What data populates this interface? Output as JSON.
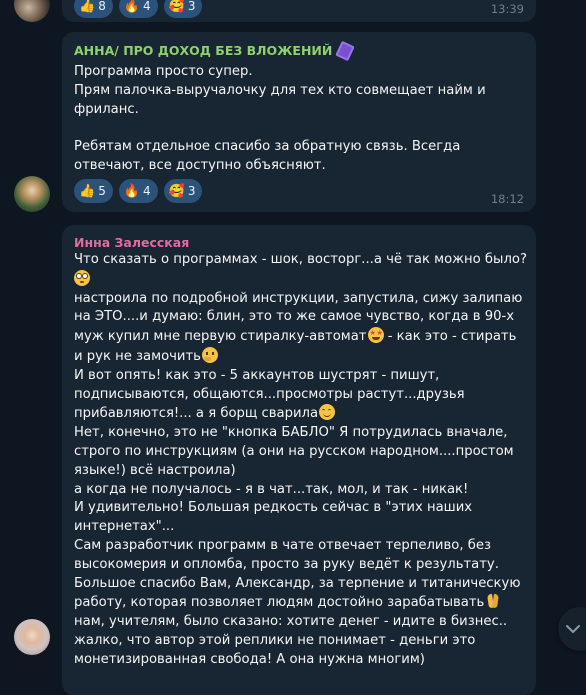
{
  "top_message": {
    "reactions": [
      {
        "icon": "thumbs-up-emoji",
        "count": "8"
      },
      {
        "icon": "fire-emoji",
        "count": "4"
      },
      {
        "icon": "heart-face-emoji",
        "count": "3"
      }
    ],
    "time": "13:39"
  },
  "message_anna": {
    "author": "АННА/ ПРО ДОХОД БЕЗ ВЛОЖЕНИЙ",
    "author_color": "#8fd16a",
    "lines": [
      "Программа просто супер.",
      "Прям палочка-выручалочку  для тех кто совмещает найм и",
      "фриланс.",
      "",
      "Ребятам отдельное спасибо за обратную связь. Всегда",
      "отвечают,  все доступно объясняют."
    ],
    "reactions": [
      {
        "icon": "thumbs-up-emoji",
        "count": "5"
      },
      {
        "icon": "fire-emoji",
        "count": "4"
      },
      {
        "icon": "heart-face-emoji",
        "count": "3"
      }
    ],
    "time": "18:12"
  },
  "message_inna": {
    "author": "Инна Залесская",
    "author_color": "#e56a9e",
    "lines": [
      "Что сказать о программах - шок, восторг...а чё так можно было?",
      "настроила по подробной инструкции, запустила, сижу залипаю",
      "на ЭТО....и думаю: блин, это то же самое чувство, когда в 90-х",
      "муж купил мне первую стиралку-автомат",
      " - как это - стирать",
      "и рук не замочить",
      "И вот опять! как это - 5 аккаунтов шустрят - пишут,",
      "подписываются, общаются...просмотры растут...друзья",
      "прибавляются!... а я борщ сварила",
      "Нет, конечно, это не \"кнопка БАБЛО\" Я потрудилась вначале,",
      "строго по инструкциям (а они на русском народном....простом",
      "языке!) всё настроила)",
      "а когда не получалось - я в чат...так, мол, и так - никак!",
      "И удивительно! Большая редкость сейчас в \"этих наших",
      "интернетах\"...",
      "Сам разработчик программ в чате отвечает терпеливо, без",
      "высокомерия и опломба, просто за руку ведёт к результату.",
      "Большое спасибо Вам, Александр, за терпение и титаническую",
      "работу, которая позволяет людям достойно зарабатывать",
      "нам, учителям, было сказано: хотите денег - идите в бизнес..",
      "жалко, что автор этой реплики не понимает - деньги это",
      "монетизированная свобода! А она нужна многим)"
    ]
  },
  "emoji_names": {
    "flushed": "flushed-face-emoji",
    "starstruck": "star-struck-emoji",
    "thinking": "thinking-face-emoji",
    "smiling": "smiling-face-emoji",
    "pray": "folded-hands-emoji",
    "purple_card": "purple-card-emoji"
  },
  "colors": {
    "background": "#0e1621",
    "bubble": "#182533",
    "reaction_pill": "#2b5278",
    "time": "#6d7f8f"
  }
}
